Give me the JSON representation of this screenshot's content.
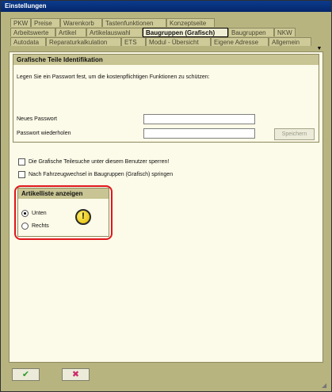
{
  "window": {
    "title": "Einstellungen"
  },
  "tabs": {
    "row1": [
      "PKW",
      "Preise",
      "Warenkorb",
      "Tastenfunktionen",
      "Konzeptseite"
    ],
    "row2": [
      "Arbeitswerte",
      "Artikel",
      "Artikelauswahl",
      "Baugruppen (Grafisch)",
      "Baugruppen",
      "NKW"
    ],
    "row3": [
      "Autodata",
      "Reparaturkalkulation",
      "ETS",
      "Modul - Übersicht",
      "Eigene Adresse",
      "Allgemein"
    ],
    "active": "Baugruppen (Grafisch)"
  },
  "identifikation": {
    "title": "Grafische Teile Identifikation",
    "description": "Legen Sie ein Passwort fest, um die kostenpflichtigen Funktionen zu schützen:",
    "new_password_label": "Neues Passwort",
    "new_password_value": "",
    "repeat_password_label": "Passwort wiederholen",
    "repeat_password_value": "",
    "save_label": "Speichern"
  },
  "options": {
    "lock_label": "Die Grafische Teilesuche unter diesem Benutzer sperren!",
    "lock_checked": false,
    "jump_label": "Nach Fahrzeugwechsel in Baugruppen (Grafisch) springen",
    "jump_checked": false
  },
  "artikelliste": {
    "title": "Artikelliste anzeigen",
    "option_below": "Unten",
    "option_right": "Rechts",
    "selected": "Unten",
    "info_glyph": "!"
  },
  "footer": {
    "ok_glyph": "✔",
    "cancel_glyph": "✖",
    "ok_color": "#2e9a2e",
    "cancel_color": "#cc2b6a"
  },
  "icons": {
    "info": "info-icon",
    "ok": "checkmark-icon",
    "cancel": "cross-icon"
  }
}
